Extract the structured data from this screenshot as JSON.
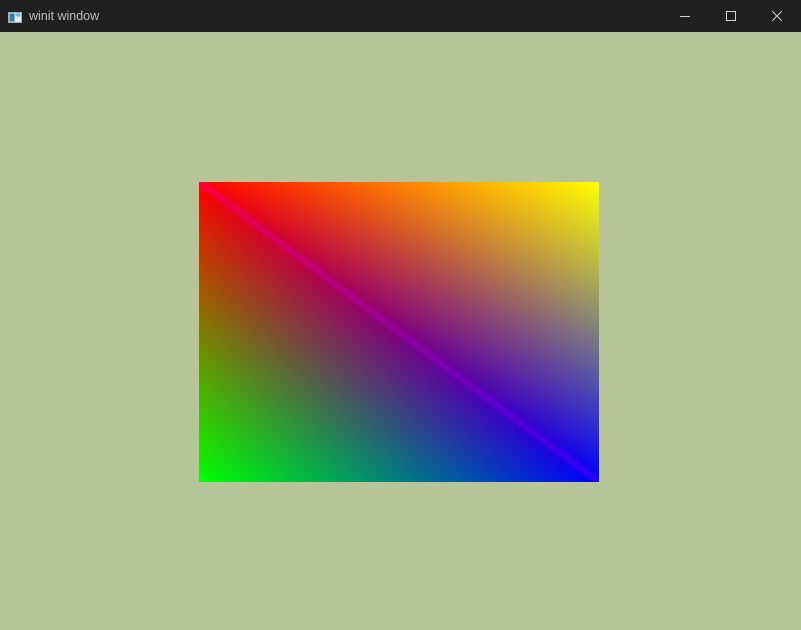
{
  "window": {
    "title": "winit window",
    "background_color": "#b7c497",
    "titlebar_color": "#202020"
  },
  "titlebar": {
    "icon": "app-window-icon",
    "controls": [
      "minimize-icon",
      "maximize-icon",
      "close-icon"
    ]
  },
  "canvas": {
    "description_colors": {
      "top_left": "#ff0000",
      "top_right": "#ffff00",
      "bottom_left": "#00ff00",
      "bottom_right": "#0000ff",
      "diagonal": "#a000ff"
    }
  }
}
